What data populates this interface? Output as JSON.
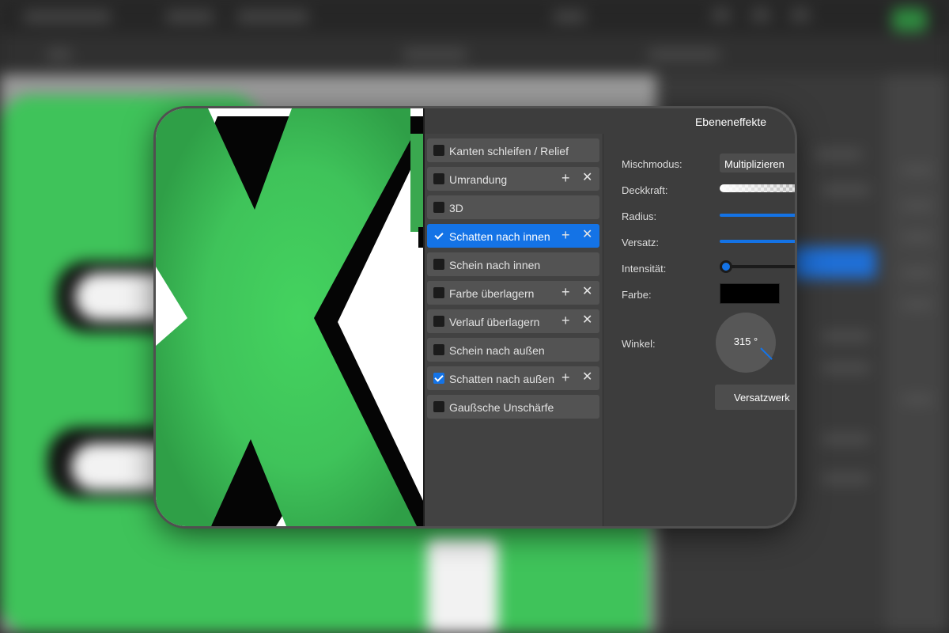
{
  "panel": {
    "title": "Ebeneneffekte"
  },
  "effects": [
    {
      "label": "Kanten schleifen / Relief",
      "checked": false,
      "active": false,
      "removable": false
    },
    {
      "label": "Umrandung",
      "checked": false,
      "active": false,
      "removable": true
    },
    {
      "label": "3D",
      "checked": false,
      "active": false,
      "removable": false
    },
    {
      "label": "Schatten nach innen",
      "checked": true,
      "active": true,
      "removable": true
    },
    {
      "label": "Schein nach innen",
      "checked": false,
      "active": false,
      "removable": false
    },
    {
      "label": "Farbe überlagern",
      "checked": false,
      "active": false,
      "removable": true
    },
    {
      "label": "Verlauf überlagern",
      "checked": false,
      "active": false,
      "removable": true
    },
    {
      "label": "Schein nach außen",
      "checked": false,
      "active": false,
      "removable": false
    },
    {
      "label": "Schatten nach außen",
      "checked": true,
      "active": false,
      "removable": true
    },
    {
      "label": "Gaußsche Unschärfe",
      "checked": false,
      "active": false,
      "removable": false
    }
  ],
  "icons": {
    "add": "plus-icon",
    "remove": "close-icon",
    "check": "check-icon"
  },
  "settings": {
    "blend_mode_label": "Mischmodus:",
    "blend_mode_value": "Multiplizieren",
    "opacity_label": "Deckkraft:",
    "radius_label": "Radius:",
    "offset_label": "Versatz:",
    "intensity_label": "Intensität:",
    "color_label": "Farbe:",
    "color_value": "#000000",
    "angle_label": "Winkel:",
    "angle_value": "315 °",
    "offset_button_label": "Versatzwerk"
  },
  "colors": {
    "accent": "#1473e6",
    "letter_green": "#40c45a"
  }
}
